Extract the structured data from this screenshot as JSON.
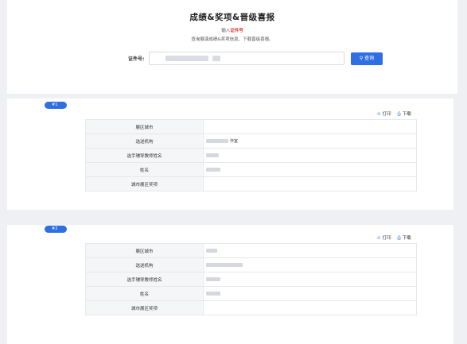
{
  "header": {
    "title": "成绩&奖项&晋级喜报",
    "hint_prefix": "输入",
    "hint_highlight": "证件号",
    "subtitle": "查询展演成绩&奖项信息、下载晋级喜报。",
    "search_label": "证件号:",
    "search_button": "查询",
    "search_icon": "search-icon"
  },
  "actions": {
    "print": "打印",
    "download": "下载"
  },
  "results": [
    {
      "badge": "#1",
      "rows": [
        {
          "label": "展区城市",
          "value": ""
        },
        {
          "label": "选送机构",
          "value": "作室"
        },
        {
          "label": "选手辅导教师姓名",
          "value": ""
        },
        {
          "label": "姓名",
          "value": ""
        },
        {
          "label": "城市展区奖项",
          "value": ""
        }
      ]
    },
    {
      "badge": "#2",
      "rows": [
        {
          "label": "展区城市",
          "value": ""
        },
        {
          "label": "选送机构",
          "value": ""
        },
        {
          "label": "选手辅导教师姓名",
          "value": ""
        },
        {
          "label": "姓名",
          "value": ""
        },
        {
          "label": "城市展区奖项",
          "value": ""
        }
      ]
    }
  ],
  "colors": {
    "accent": "#2f6fe4",
    "highlight": "#e53935",
    "background": "#eef0f3"
  }
}
